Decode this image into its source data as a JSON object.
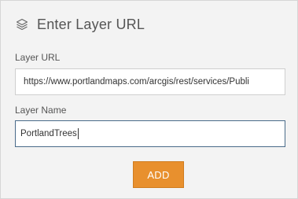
{
  "panel": {
    "title": "Enter Layer URL",
    "title_icon": "layers-icon"
  },
  "form": {
    "url_label": "Layer URL",
    "url_value": "https://www.portlandmaps.com/arcgis/rest/services/Publi",
    "name_label": "Layer Name",
    "name_value": "PortlandTrees"
  },
  "actions": {
    "add_label": "ADD"
  },
  "colors": {
    "accent": "#e8902e",
    "panel_bg": "#f3f3f3",
    "focus_border": "#4a6b8a"
  }
}
